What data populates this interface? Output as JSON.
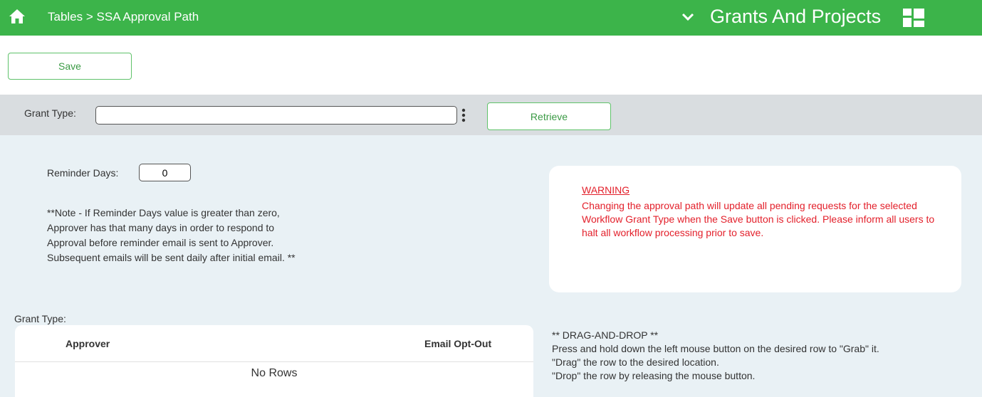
{
  "header": {
    "breadcrumb": "Tables > SSA Approval Path",
    "module_title": "Grants And Projects",
    "bg_color": "#3cb44a"
  },
  "toolbar": {
    "save_label": "Save"
  },
  "grant_type": {
    "label": "Grant Type:",
    "value": "",
    "retrieve_label": "Retrieve"
  },
  "reminder": {
    "label": "Reminder Days:",
    "value": "0",
    "note_lines": [
      "**Note - If Reminder Days value is greater than zero,",
      "Approver has that many days in order to respond to",
      "Approval before reminder email is sent to Approver.",
      "Subsequent emails will be sent daily after initial email. **"
    ]
  },
  "warning": {
    "title": "WARNING",
    "text": "Changing the approval path will update all pending requests for the selected Workflow Grant Type when the Save button is clicked. Please inform all users to halt all workflow processing prior to save.",
    "color": "#e3202b"
  },
  "approvers": {
    "label": "Grant Type:",
    "columns": [
      "Approver",
      "Email Opt-Out"
    ],
    "empty_text": "No Rows"
  },
  "drag_drop": {
    "lines": [
      "** DRAG-AND-DROP **",
      "Press and hold down the left mouse button on the desired row to \"Grab\" it.",
      "\"Drag\" the row to the desired location.",
      "\"Drop\" the row by releasing the mouse button."
    ]
  },
  "icons": {
    "home": "home-icon",
    "chevron": "chevron-down-icon",
    "grid": "dashboard-grid-icon",
    "kebab": "vertical-ellipsis-icon"
  }
}
